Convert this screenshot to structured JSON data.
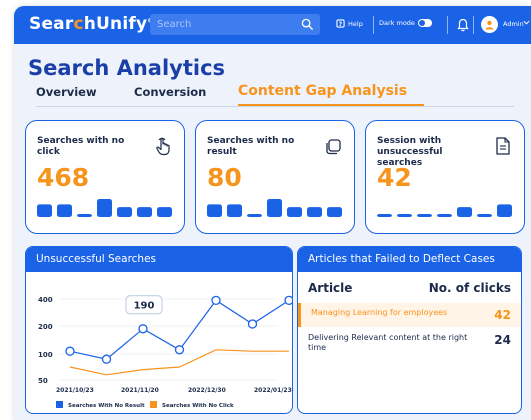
{
  "app": {
    "logo_prefix": "Sear",
    "logo_c": "c",
    "logo_suffix": "hUnify",
    "logo_tm": "®"
  },
  "topbar": {
    "search_placeholder": "Search",
    "help_label": "Help",
    "dark_mode_label": "Dark mode",
    "admin_label": "Admin"
  },
  "page": {
    "title": "Search Analytics",
    "tabs": [
      {
        "label": "Overview",
        "active": false
      },
      {
        "label": "Conversion",
        "active": false
      },
      {
        "label": "Content Gap Analysis",
        "active": true
      }
    ]
  },
  "cards": [
    {
      "label": "Searches with no click",
      "value": "468",
      "icon": "pointer-hand-icon",
      "bars": [
        0.7,
        0.7,
        0.15,
        1.0,
        0.55,
        0.55,
        0.55
      ]
    },
    {
      "label": "Searches with no result",
      "value": "80",
      "icon": "square-stack-icon",
      "bars": [
        0.7,
        0.7,
        0.15,
        1.0,
        0.55,
        0.55,
        0.55
      ]
    },
    {
      "label": "Session with unsuccessful searches",
      "value": "42",
      "icon": "document-icon",
      "bars": [
        0.15,
        0.15,
        0.15,
        0.15,
        0.55,
        0.15,
        0.7
      ]
    }
  ],
  "unsuccessful_panel": {
    "title": "Unsuccessful Searches",
    "tooltip_value": "190",
    "legend": [
      {
        "name": "Searches With No Result",
        "color": "#1a62e6"
      },
      {
        "name": "Searches With No Click",
        "color": "#f7941d"
      }
    ]
  },
  "chart_data": {
    "type": "line",
    "x": [
      "2021/10/23",
      "2021/11/20",
      "2022/12/30",
      "2022/01/23"
    ],
    "y_ticks": [
      50,
      100,
      200,
      400
    ],
    "series": [
      {
        "name": "Searches With No Result",
        "color": "#1a62e6",
        "values": [
          110,
          90,
          190,
          115,
          390,
          215,
          390
        ]
      },
      {
        "name": "Searches With No Click",
        "color": "#f7941d",
        "values": [
          75,
          60,
          70,
          75,
          115,
          110,
          110
        ]
      }
    ]
  },
  "articles_panel": {
    "title": "Articles that Failed to Deflect Cases",
    "col_article": "Article",
    "col_clicks": "No. of clicks",
    "rows": [
      {
        "name": "Managing Learning for employees",
        "clicks": "42",
        "highlight": true
      },
      {
        "name": "Delivering Relevant content at the right time",
        "clicks": "24",
        "highlight": false
      }
    ]
  },
  "colors": {
    "primary": "#1a62e6",
    "accent": "#f7941d",
    "title": "#1a3fa8"
  }
}
